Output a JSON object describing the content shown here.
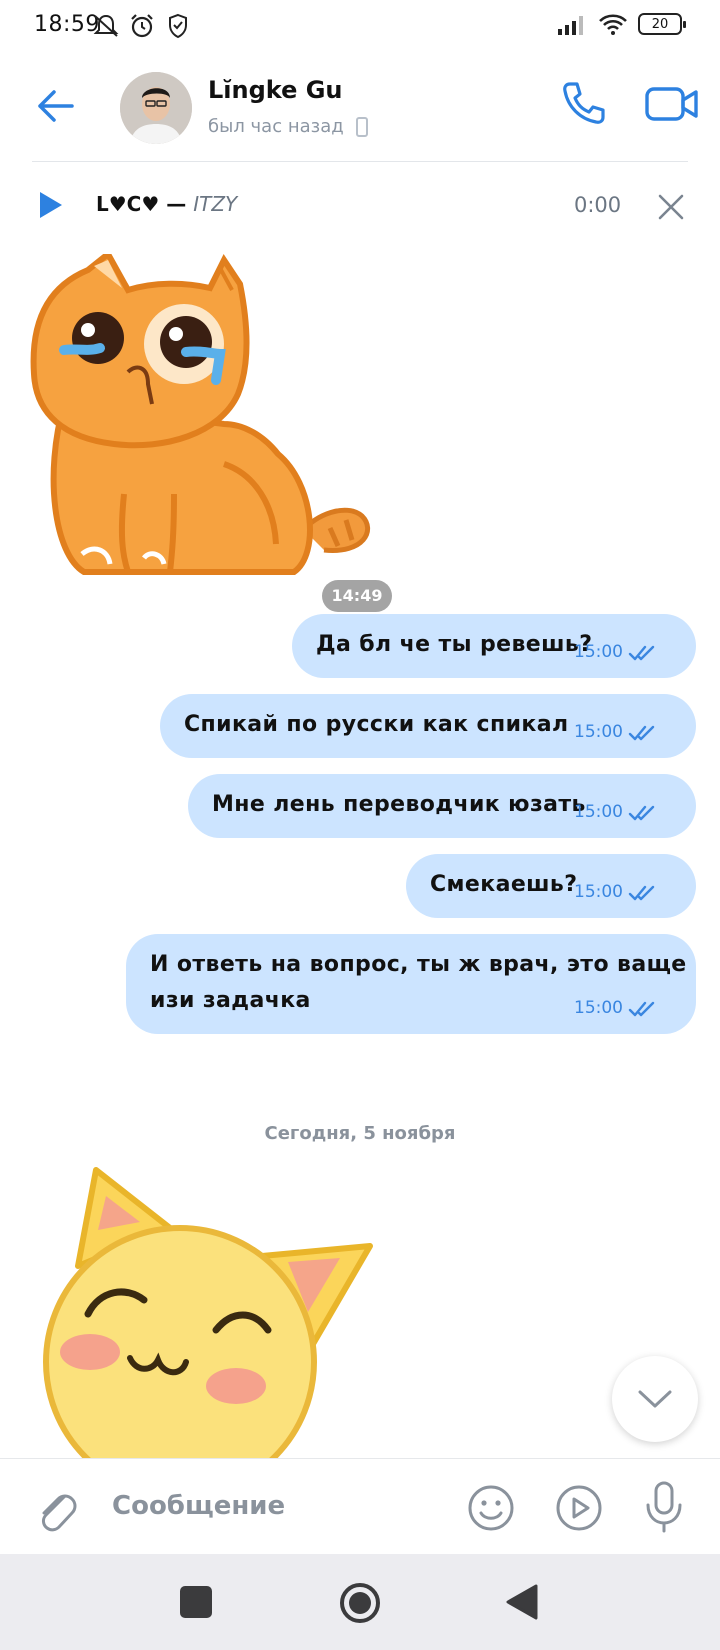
{
  "status_bar": {
    "time": "18:59",
    "battery": "20",
    "icons": [
      "notifications-off-icon",
      "alarm-icon",
      "shield-icon",
      "signal-icon",
      "wifi-icon",
      "battery-icon"
    ]
  },
  "header": {
    "name": "Lĭngke Gu",
    "status": "был час назад"
  },
  "player": {
    "title": "L♥C♥",
    "separator": " — ",
    "artist": "ITZY",
    "time": "0:00"
  },
  "messages": [
    {
      "lines": [
        "Да бл че ты ревешь?"
      ],
      "time": "15:00"
    },
    {
      "lines": [
        "Спикай по русски как спикал"
      ],
      "time": "15:00"
    },
    {
      "lines": [
        "Мне лень переводчик юзать"
      ],
      "time": "15:00"
    },
    {
      "lines": [
        "Смекаешь?"
      ],
      "time": "15:00"
    },
    {
      "lines": [
        "И ответь на вопрос, ты ж врач, это ваще",
        "изи задачка"
      ],
      "time": "15:00"
    }
  ],
  "sticker_1": {
    "time": "14:49"
  },
  "date_separator": "Сегодня, 5 ноября",
  "composer": {
    "placeholder": "Сообщение"
  },
  "colors": {
    "accent": "#2d81e0",
    "bubble": "#cce4ff",
    "time_blue": "#3a86e0"
  }
}
